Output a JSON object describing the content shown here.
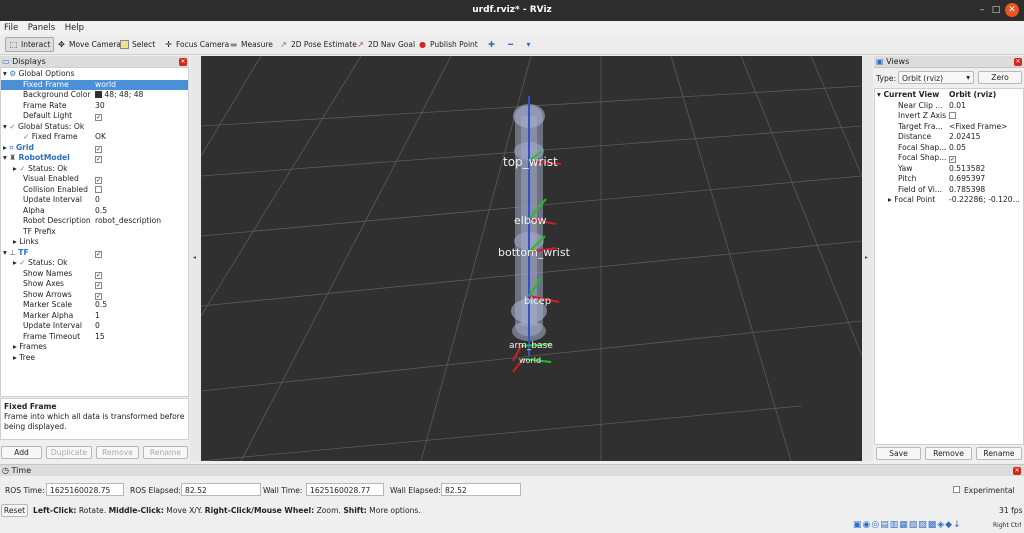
{
  "window": {
    "title": "urdf.rviz* - RViz"
  },
  "menu": [
    "File",
    "Panels",
    "Help"
  ],
  "toolbar": {
    "tools": [
      "Interact",
      "Move Camera",
      "Select",
      "Focus Camera",
      "Measure",
      "2D Pose Estimate",
      "2D Nav Goal",
      "Publish Point"
    ]
  },
  "displays": {
    "title": "Displays",
    "rows": [
      {
        "key": "Global Options",
        "value": ""
      },
      {
        "key": "Fixed Frame",
        "value": "world"
      },
      {
        "key": "Background Color",
        "value": "48; 48; 48"
      },
      {
        "key": "Frame Rate",
        "value": "30"
      },
      {
        "key": "Default Light",
        "value": "✓"
      },
      {
        "key": "Global Status: Ok",
        "value": ""
      },
      {
        "key": "Fixed Frame",
        "value": "OK"
      },
      {
        "key": "Grid",
        "value": "✓"
      },
      {
        "key": "RobotModel",
        "value": "✓"
      },
      {
        "key": "Status: Ok",
        "value": ""
      },
      {
        "key": "Visual Enabled",
        "value": "✓"
      },
      {
        "key": "Collision Enabled",
        "value": ""
      },
      {
        "key": "Update Interval",
        "value": "0"
      },
      {
        "key": "Alpha",
        "value": "0.5"
      },
      {
        "key": "Robot Description",
        "value": "robot_description"
      },
      {
        "key": "TF Prefix",
        "value": ""
      },
      {
        "key": "Links",
        "value": ""
      },
      {
        "key": "TF",
        "value": "✓"
      },
      {
        "key": "Status: Ok",
        "value": ""
      },
      {
        "key": "Show Names",
        "value": "✓"
      },
      {
        "key": "Show Axes",
        "value": "✓"
      },
      {
        "key": "Show Arrows",
        "value": "✓"
      },
      {
        "key": "Marker Scale",
        "value": "0.5"
      },
      {
        "key": "Marker Alpha",
        "value": "1"
      },
      {
        "key": "Update Interval",
        "value": "0"
      },
      {
        "key": "Frame Timeout",
        "value": "15"
      },
      {
        "key": "Frames",
        "value": ""
      },
      {
        "key": "Tree",
        "value": ""
      }
    ],
    "description_title": "Fixed Frame",
    "description_text": "Frame into which all data is transformed before being displayed.",
    "buttons": [
      "Add",
      "Duplicate",
      "Remove",
      "Rename"
    ]
  },
  "scene": {
    "frames": [
      "top_wrist",
      "elbow",
      "bottom_wrist",
      "bicep",
      "arm_base",
      "world"
    ]
  },
  "views": {
    "title": "Views",
    "type_label": "Type:",
    "type_value": "Orbit (rviz)",
    "zero_label": "Zero",
    "rows": [
      {
        "key": "Current View",
        "value": "Orbit (rviz)"
      },
      {
        "key": "Near Clip ...",
        "value": "0.01"
      },
      {
        "key": "Invert Z Axis",
        "value": ""
      },
      {
        "key": "Target Fra...",
        "value": "<Fixed Frame>"
      },
      {
        "key": "Distance",
        "value": "2.02415"
      },
      {
        "key": "Focal Shap...",
        "value": "0.05"
      },
      {
        "key": "Focal Shap...",
        "value": "✓"
      },
      {
        "key": "Yaw",
        "value": "0.513582"
      },
      {
        "key": "Pitch",
        "value": "0.695397"
      },
      {
        "key": "Field of Vi...",
        "value": "0.785398"
      },
      {
        "key": "Focal Point",
        "value": "-0.22286; -0.120..."
      }
    ],
    "buttons": [
      "Save",
      "Remove",
      "Rename"
    ]
  },
  "time": {
    "title": "Time",
    "ros_time_label": "ROS Time:",
    "ros_time": "1625160028.75",
    "ros_elapsed_label": "ROS Elapsed:",
    "ros_elapsed": "82.52",
    "wall_time_label": "Wall Time:",
    "wall_time": "1625160028.77",
    "wall_elapsed_label": "Wall Elapsed:",
    "wall_elapsed": "82.52",
    "experimental_label": "Experimental"
  },
  "status": {
    "reset_label": "Reset",
    "left_click": "Left-Click:",
    "left_click_text": " Rotate. ",
    "middle_click": "Middle-Click:",
    "middle_click_text": " Move X/Y. ",
    "right_click": "Right-Click/Mouse Wheel:",
    "right_click_text": " Zoom. ",
    "shift": "Shift:",
    "shift_text": " More options.",
    "fps": "31 fps",
    "right_ctrl": "Right Ctrl"
  }
}
